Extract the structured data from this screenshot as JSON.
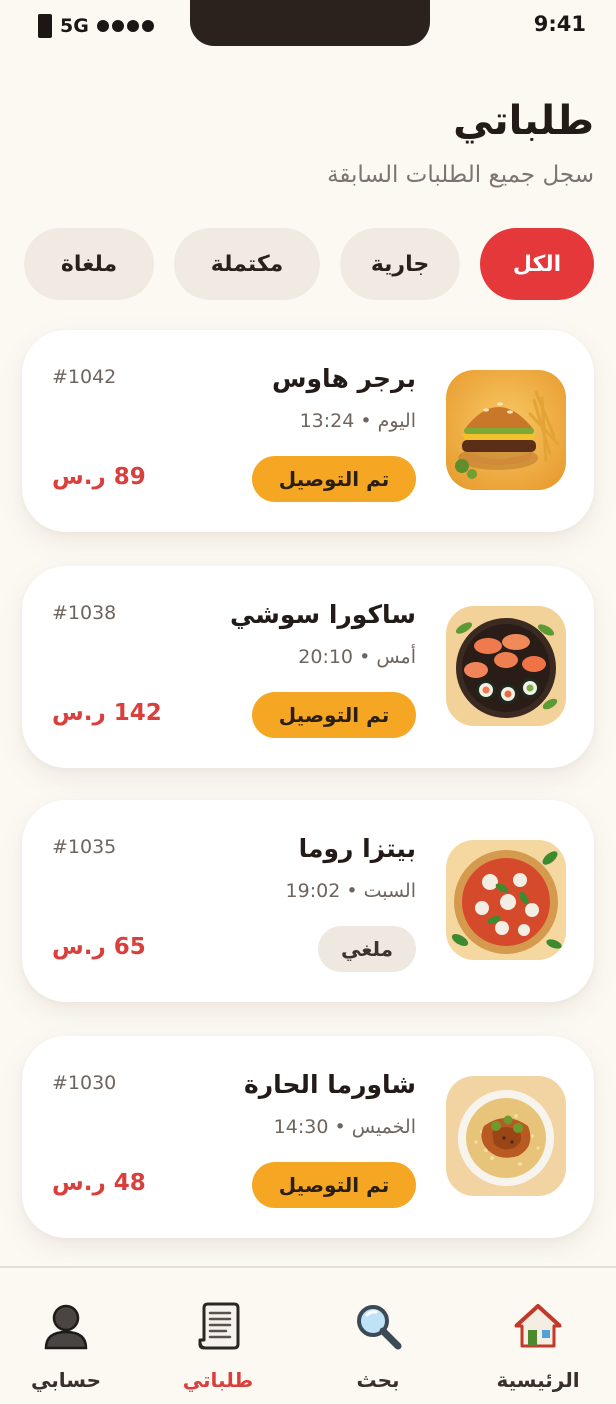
{
  "status_bar": {
    "network": "5G",
    "time": "9:41"
  },
  "header": {
    "title": "طلباتي",
    "subtitle": "سجل جميع الطلبات السابقة"
  },
  "filters": [
    {
      "label": "الكل",
      "active": true
    },
    {
      "label": "جارية",
      "active": false
    },
    {
      "label": "مكتملة",
      "active": false
    },
    {
      "label": "ملغاة",
      "active": false
    }
  ],
  "orders": [
    {
      "restaurant": "برجر هاوس",
      "time": "اليوم • 13:24",
      "status": "تم التوصيل",
      "id": "#1042",
      "price": "89 ر.س",
      "image": "burger-image"
    },
    {
      "restaurant": "ساكورا سوشي",
      "time": "أمس • 20:10",
      "status": "تم التوصيل",
      "id": "#1038",
      "price": "142 ر.س",
      "image": "sushi-image"
    },
    {
      "restaurant": "بيتزا روما",
      "time": "السبت • 19:02",
      "status": "ملغي",
      "id": "#1035",
      "price": "65 ر.س",
      "image": "pizza-image"
    },
    {
      "restaurant": "شاورما الحارة",
      "time": "الخميس • 14:30",
      "status": "تم التوصيل",
      "id": "#1030",
      "price": "48 ر.س",
      "image": "shawarma-image"
    }
  ],
  "nav": [
    {
      "label": "الرئيسية",
      "icon": "home-icon",
      "active": false
    },
    {
      "label": "بحث",
      "icon": "search-icon",
      "active": false
    },
    {
      "label": "طلباتي",
      "icon": "receipt-icon",
      "active": true
    },
    {
      "label": "حسابي",
      "icon": "profile-icon",
      "active": false
    }
  ],
  "colors": {
    "accent": "#E4383A",
    "price": "#D8403D",
    "delivered": "#F5A623",
    "cancelled": "#EEE8E1",
    "background": "#FCF9F3"
  }
}
